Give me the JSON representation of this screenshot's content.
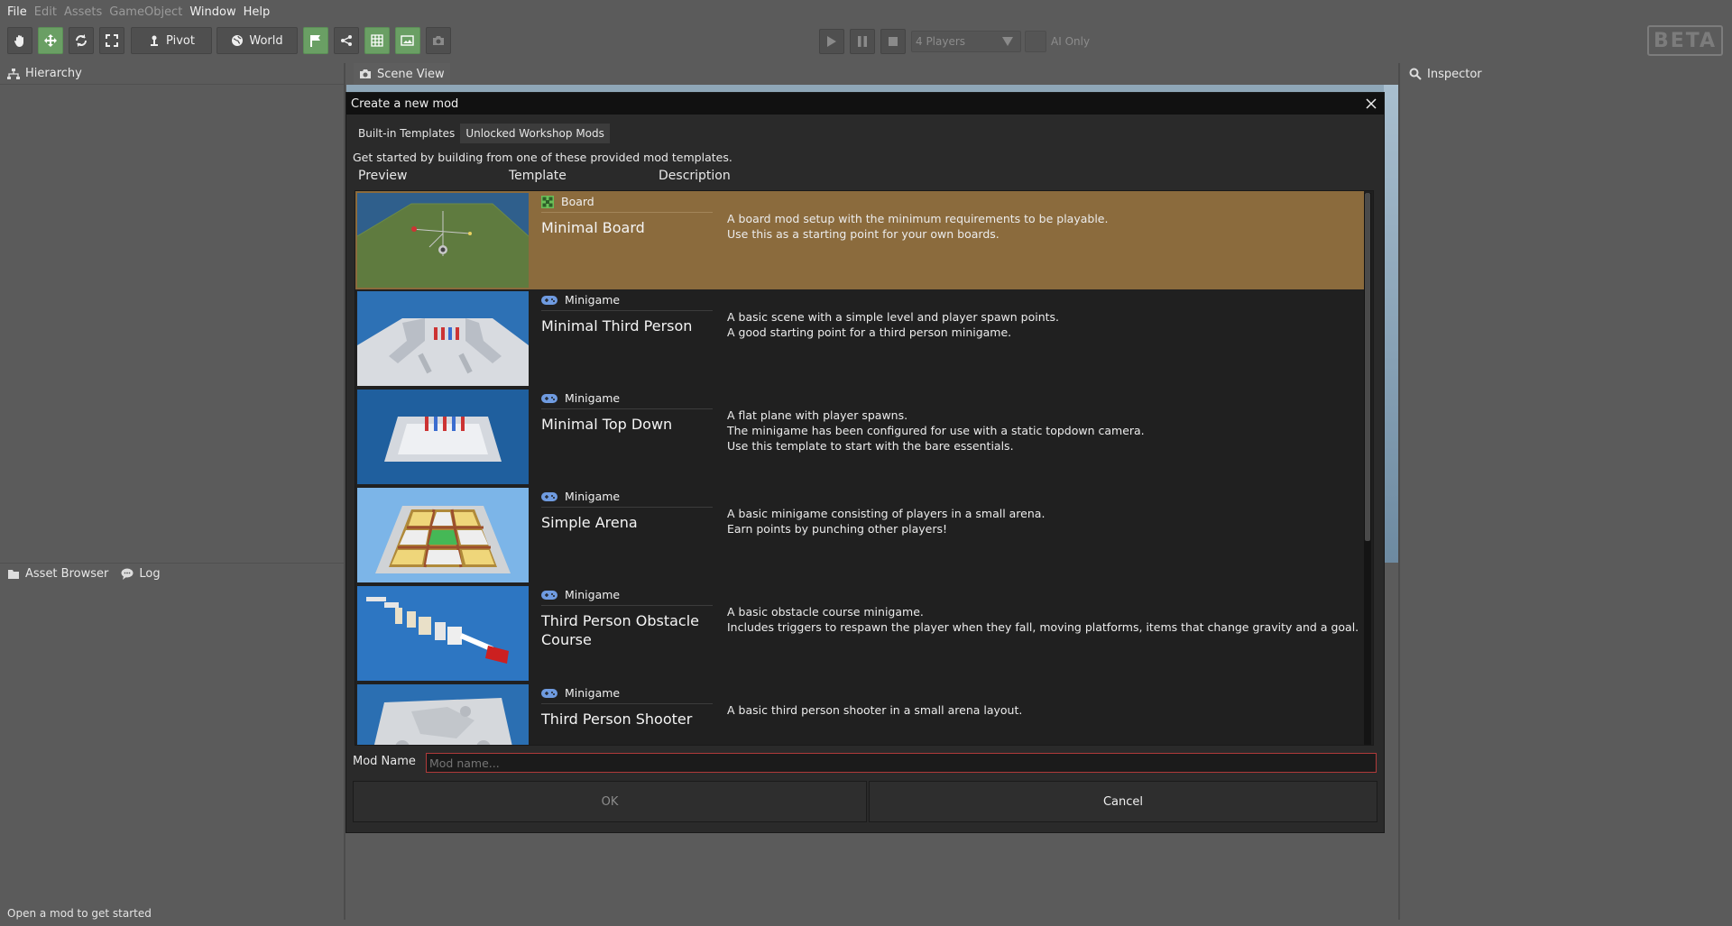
{
  "menu": {
    "items": [
      {
        "label": "File",
        "enabled": true
      },
      {
        "label": "Edit",
        "enabled": false
      },
      {
        "label": "Assets",
        "enabled": false
      },
      {
        "label": "GameObject",
        "enabled": false
      },
      {
        "label": "Window",
        "enabled": true
      },
      {
        "label": "Help",
        "enabled": true
      }
    ]
  },
  "toolbar": {
    "pivot_label": "Pivot",
    "world_label": "World",
    "players_value": "4 Players",
    "ai_only_label": "AI Only",
    "beta_badge": "BETA"
  },
  "panels": {
    "hierarchy": "Hierarchy",
    "scene_view": "Scene View",
    "inspector": "Inspector",
    "asset_browser": "Asset Browser",
    "log": "Log"
  },
  "status": "Open a mod to get started",
  "dialog": {
    "title": "Create a new mod",
    "tabs": [
      "Built-in Templates",
      "Unlocked Workshop Mods"
    ],
    "active_tab": 1,
    "intro": "Get started by building from one of these provided mod templates.",
    "columns": {
      "preview": "Preview",
      "template": "Template",
      "description": "Description"
    },
    "templates": [
      {
        "category": "Board",
        "name": "Minimal Board",
        "selected": true,
        "description": [
          "A board mod setup with the minimum requirements to be playable.",
          "Use this as a starting point for your own boards."
        ]
      },
      {
        "category": "Minigame",
        "name": "Minimal Third Person",
        "selected": false,
        "description": [
          "A basic scene with a simple level and player spawn points.",
          "A good starting point for a third person minigame."
        ]
      },
      {
        "category": "Minigame",
        "name": "Minimal Top Down",
        "selected": false,
        "description": [
          "A flat plane with player spawns.",
          "The minigame has been configured for use with a static topdown camera.",
          "Use this template to start with the bare essentials."
        ]
      },
      {
        "category": "Minigame",
        "name": "Simple Arena",
        "selected": false,
        "description": [
          "A basic minigame consisting of players in a small arena.",
          "Earn points by punching other players!"
        ]
      },
      {
        "category": "Minigame",
        "name": "Third Person Obstacle Course",
        "selected": false,
        "description": [
          "A basic obstacle course minigame.",
          "Includes triggers to respawn the player when they fall, moving platforms, items that change gravity and a goal."
        ]
      },
      {
        "category": "Minigame",
        "name": "Third Person Shooter",
        "selected": false,
        "description": [
          "A basic third person shooter in a small arena layout."
        ]
      }
    ],
    "mod_name_label": "Mod Name",
    "mod_name_placeholder": "Mod name...",
    "mod_name_value": "",
    "ok_label": "OK",
    "cancel_label": "Cancel"
  },
  "colors": {
    "background": "#5b5b5b",
    "dialog": "#2a2a2a",
    "selected_row": "#8b6b3d",
    "accent_green": "#6a9f64",
    "minigame_icon": "#6f9be0",
    "board_icon": "#6abf58",
    "input_error_border": "#b03a3a"
  }
}
